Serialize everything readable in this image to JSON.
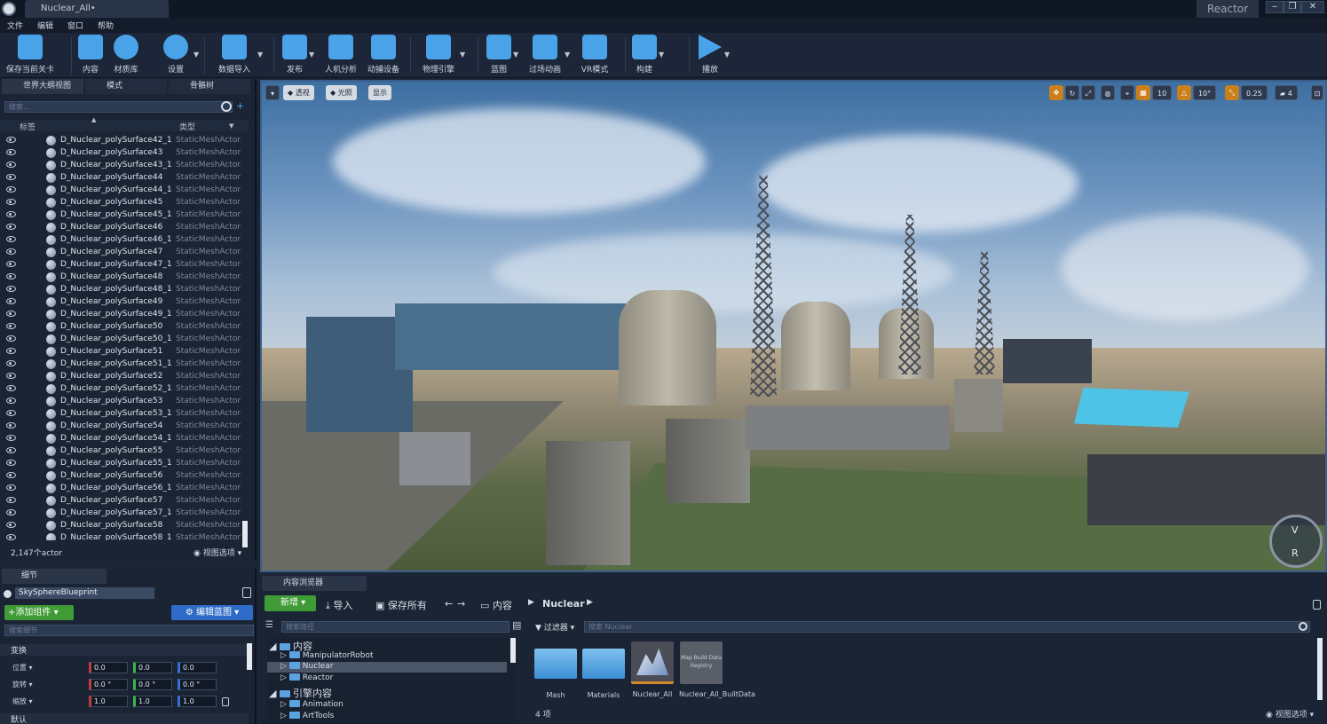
{
  "app": {
    "document_tab": "Nuclear_All•",
    "project_name": "Reactor",
    "window_controls": [
      "‒",
      "❐",
      "✕"
    ]
  },
  "menu": [
    "文件",
    "编辑",
    "窗口",
    "帮助"
  ],
  "toolbar": {
    "items": [
      {
        "label": "保存当前关卡",
        "icon": "save-icon",
        "color": "#4aa3e8"
      },
      {
        "label": "内容",
        "icon": "content-grid-icon",
        "color": "#4aa3e8"
      },
      {
        "label": "材质库",
        "icon": "material-spheres-icon",
        "color": "#4aa3e8"
      },
      {
        "label": "设置",
        "icon": "gear-icon",
        "color": "#4aa3e8"
      },
      {
        "label": "数据导入",
        "icon": "data-import-icon",
        "color": "#4aa3e8"
      },
      {
        "label": "发布",
        "icon": "publish-icon",
        "color": "#4aa3e8"
      },
      {
        "label": "人机分析",
        "icon": "ergonomics-icon",
        "color": "#4aa3e8"
      },
      {
        "label": "动捕设备",
        "icon": "motion-capture-icon",
        "color": "#4aa3e8"
      },
      {
        "label": "物理引擎",
        "icon": "physics-icon",
        "color": "#4aa3e8"
      },
      {
        "label": "蓝图",
        "icon": "blueprint-icon",
        "color": "#4aa3e8"
      },
      {
        "label": "过场动画",
        "icon": "cinematic-icon",
        "color": "#4aa3e8"
      },
      {
        "label": "VR模式",
        "icon": "vr-icon",
        "color": "#4aa3e8"
      },
      {
        "label": "构建",
        "icon": "build-icon",
        "color": "#4aa3e8"
      },
      {
        "label": "播放",
        "icon": "play-icon",
        "color": "#4aa3e8"
      }
    ]
  },
  "outliner": {
    "tabs": [
      "世界大纲视图",
      "模式",
      "骨骼树"
    ],
    "search_placeholder": "搜索...",
    "col_label": "标签",
    "col_type": "类型",
    "rows": [
      {
        "name": "D_Nuclear_polySurface42_1",
        "type": "StaticMeshActor"
      },
      {
        "name": "D_Nuclear_polySurface43",
        "type": "StaticMeshActor"
      },
      {
        "name": "D_Nuclear_polySurface43_1",
        "type": "StaticMeshActor"
      },
      {
        "name": "D_Nuclear_polySurface44",
        "type": "StaticMeshActor"
      },
      {
        "name": "D_Nuclear_polySurface44_1",
        "type": "StaticMeshActor"
      },
      {
        "name": "D_Nuclear_polySurface45",
        "type": "StaticMeshActor"
      },
      {
        "name": "D_Nuclear_polySurface45_1",
        "type": "StaticMeshActor"
      },
      {
        "name": "D_Nuclear_polySurface46",
        "type": "StaticMeshActor"
      },
      {
        "name": "D_Nuclear_polySurface46_1",
        "type": "StaticMeshActor"
      },
      {
        "name": "D_Nuclear_polySurface47",
        "type": "StaticMeshActor"
      },
      {
        "name": "D_Nuclear_polySurface47_1",
        "type": "StaticMeshActor"
      },
      {
        "name": "D_Nuclear_polySurface48",
        "type": "StaticMeshActor"
      },
      {
        "name": "D_Nuclear_polySurface48_1",
        "type": "StaticMeshActor"
      },
      {
        "name": "D_Nuclear_polySurface49",
        "type": "StaticMeshActor"
      },
      {
        "name": "D_Nuclear_polySurface49_1",
        "type": "StaticMeshActor"
      },
      {
        "name": "D_Nuclear_polySurface50",
        "type": "StaticMeshActor"
      },
      {
        "name": "D_Nuclear_polySurface50_1",
        "type": "StaticMeshActor"
      },
      {
        "name": "D_Nuclear_polySurface51",
        "type": "StaticMeshActor"
      },
      {
        "name": "D_Nuclear_polySurface51_1",
        "type": "StaticMeshActor"
      },
      {
        "name": "D_Nuclear_polySurface52",
        "type": "StaticMeshActor"
      },
      {
        "name": "D_Nuclear_polySurface52_1",
        "type": "StaticMeshActor"
      },
      {
        "name": "D_Nuclear_polySurface53",
        "type": "StaticMeshActor"
      },
      {
        "name": "D_Nuclear_polySurface53_1",
        "type": "StaticMeshActor"
      },
      {
        "name": "D_Nuclear_polySurface54",
        "type": "StaticMeshActor"
      },
      {
        "name": "D_Nuclear_polySurface54_1",
        "type": "StaticMeshActor"
      },
      {
        "name": "D_Nuclear_polySurface55",
        "type": "StaticMeshActor"
      },
      {
        "name": "D_Nuclear_polySurface55_1",
        "type": "StaticMeshActor"
      },
      {
        "name": "D_Nuclear_polySurface56",
        "type": "StaticMeshActor"
      },
      {
        "name": "D_Nuclear_polySurface56_1",
        "type": "StaticMeshActor"
      },
      {
        "name": "D_Nuclear_polySurface57",
        "type": "StaticMeshActor"
      },
      {
        "name": "D_Nuclear_polySurface57_1",
        "type": "StaticMeshActor"
      },
      {
        "name": "D_Nuclear_polySurface58",
        "type": "StaticMeshActor"
      },
      {
        "name": "D_Nuclear_polySurface58_1",
        "type": "StaticMeshActor"
      }
    ],
    "actor_count": "2,147个actor",
    "view_options": "视图选项"
  },
  "details": {
    "tab": "细节",
    "object_name": "SkySphereBlueprint",
    "add_component": "+添加组件",
    "edit_blueprint": "编辑蓝图",
    "search_placeholder": "搜索细节",
    "transform_section": "变换",
    "default_section": "默认",
    "location_label": "位置",
    "rotation_label": "旋转",
    "scale_label": "缩放",
    "location": [
      "0.0",
      "0.0",
      "0.0"
    ],
    "rotation": [
      "0.0 °",
      "0.0 °",
      "0.0 °"
    ],
    "scale": [
      "1.0",
      "1.0",
      "1.0"
    ]
  },
  "viewport": {
    "left_buttons": [
      "透视",
      "光照",
      "显示"
    ],
    "grid_snap": "10",
    "rotation_snap": "10°",
    "scale_snap": "0.25",
    "camera_speed": "4",
    "gizmo_labels": [
      "V",
      "R"
    ]
  },
  "content_browser": {
    "tab": "内容浏览器",
    "new_label": "新增",
    "import_label": "导入",
    "save_all_label": "保存所有",
    "path": [
      "内容",
      "Nuclear"
    ],
    "search_path_placeholder": "搜索路径",
    "filters_label": "过滤器",
    "search_asset_placeholder": "搜索 Nuclear",
    "tree": {
      "content": "内容",
      "content_children": [
        "ManipulatorRobot",
        "Nuclear",
        "Reactor"
      ],
      "engine": "引擎内容",
      "engine_children": [
        "Animation",
        "ArtTools"
      ]
    },
    "assets": [
      {
        "label": "Mash",
        "kind": "folder"
      },
      {
        "label": "Materials",
        "kind": "folder"
      },
      {
        "label": "Nuclear_All",
        "kind": "level"
      },
      {
        "label": "Nuclear_All_BuiltData",
        "kind": "registry",
        "thumb_text": "Map Build Data Registry"
      }
    ],
    "item_count": "4 项",
    "view_options": "视图选项"
  }
}
